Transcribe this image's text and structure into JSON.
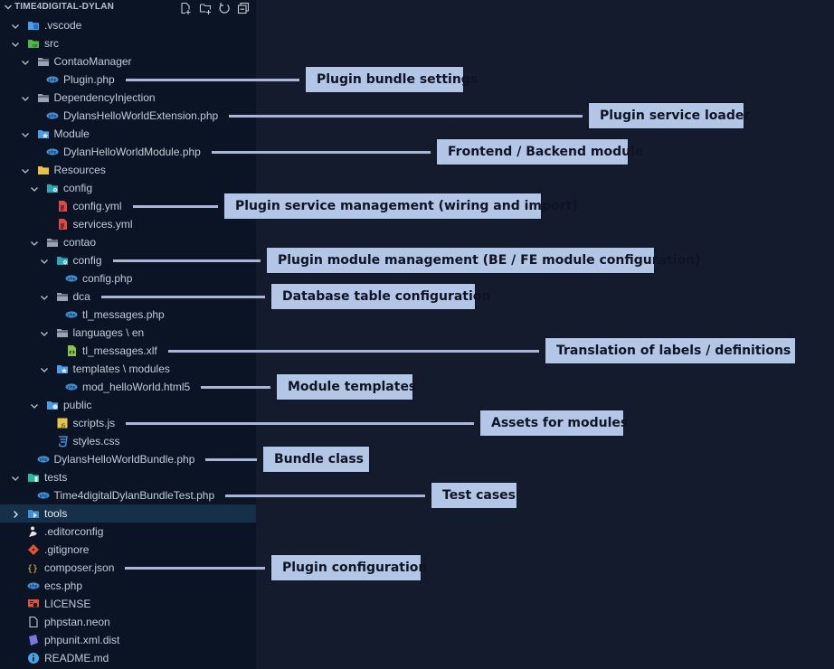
{
  "explorer": {
    "title": "TIME4DIGITAL-DYLAN",
    "toolbar": [
      {
        "name": "new-file",
        "tooltip_icon": "new-file-icon"
      },
      {
        "name": "new-folder",
        "tooltip_icon": "new-folder-icon"
      },
      {
        "name": "refresh",
        "tooltip_icon": "refresh-icon"
      },
      {
        "name": "collapse-all",
        "tooltip_icon": "collapse-all-icon"
      }
    ],
    "items": [
      {
        "label": ".vscode",
        "depth": 1,
        "type": "folder",
        "expanded": true,
        "icon": "vscode-folder-icon",
        "color": "#4a9ee8"
      },
      {
        "label": "src",
        "depth": 1,
        "type": "folder",
        "expanded": true,
        "icon": "src-folder-icon",
        "color": "#4db84a"
      },
      {
        "label": "ContaoManager",
        "depth": 2,
        "type": "folder",
        "expanded": true,
        "icon": "folder-icon",
        "color": "#9aa4b1"
      },
      {
        "label": "Plugin.php",
        "depth": 3,
        "type": "file",
        "icon": "php-icon",
        "color": "#3f8fd8"
      },
      {
        "label": "DependencyInjection",
        "depth": 2,
        "type": "folder",
        "expanded": true,
        "icon": "folder-icon",
        "color": "#9aa4b1"
      },
      {
        "label": "DylansHelloWorldExtension.php",
        "depth": 3,
        "type": "file",
        "icon": "php-icon",
        "color": "#3f8fd8"
      },
      {
        "label": "Module",
        "depth": 2,
        "type": "folder",
        "expanded": true,
        "icon": "module-folder-icon",
        "color": "#4a9ee8"
      },
      {
        "label": "DylanHelloWorldModule.php",
        "depth": 3,
        "type": "file",
        "icon": "php-icon",
        "color": "#3f8fd8"
      },
      {
        "label": "Resources",
        "depth": 2,
        "type": "folder",
        "expanded": true,
        "icon": "resources-folder-icon",
        "color": "#e8c04a"
      },
      {
        "label": "config",
        "depth": 3,
        "type": "folder",
        "expanded": true,
        "icon": "config-folder-icon",
        "color": "#2aa7b8"
      },
      {
        "label": "config.yml",
        "depth": 4,
        "type": "file",
        "icon": "yaml-icon",
        "color": "#e04848"
      },
      {
        "label": "services.yml",
        "depth": 4,
        "type": "file",
        "icon": "yaml-icon",
        "color": "#e04848"
      },
      {
        "label": "contao",
        "depth": 3,
        "type": "folder",
        "expanded": true,
        "icon": "folder-icon",
        "color": "#9aa4b1"
      },
      {
        "label": "config",
        "depth": 4,
        "type": "folder",
        "expanded": true,
        "icon": "config-folder-icon",
        "color": "#2aa7b8"
      },
      {
        "label": "config.php",
        "depth": 5,
        "type": "file",
        "icon": "php-icon",
        "color": "#3f8fd8"
      },
      {
        "label": "dca",
        "depth": 4,
        "type": "folder",
        "expanded": true,
        "icon": "folder-icon",
        "color": "#9aa4b1"
      },
      {
        "label": "tl_messages.php",
        "depth": 5,
        "type": "file",
        "icon": "php-icon",
        "color": "#3f8fd8"
      },
      {
        "label": "languages \\ en",
        "depth": 4,
        "type": "folder",
        "expanded": true,
        "icon": "folder-icon",
        "color": "#9aa4b1"
      },
      {
        "label": "tl_messages.xlf",
        "depth": 5,
        "type": "file",
        "icon": "xml-icon",
        "color": "#8bc34a"
      },
      {
        "label": "templates \\ modules",
        "depth": 4,
        "type": "folder",
        "expanded": true,
        "icon": "templates-folder-icon",
        "color": "#4a9ee8"
      },
      {
        "label": "mod_helloWorld.html5",
        "depth": 5,
        "type": "file",
        "icon": "php-icon",
        "color": "#3f8fd8"
      },
      {
        "label": "public",
        "depth": 3,
        "type": "folder",
        "expanded": true,
        "icon": "public-folder-icon",
        "color": "#4a9ee8"
      },
      {
        "label": "scripts.js",
        "depth": 4,
        "type": "file",
        "icon": "js-icon",
        "color": "#e8c44a"
      },
      {
        "label": "styles.css",
        "depth": 4,
        "type": "file",
        "icon": "css-icon",
        "color": "#3f8fd8"
      },
      {
        "label": "DylansHelloWorldBundle.php",
        "depth": 2,
        "type": "file",
        "icon": "php-icon",
        "color": "#3f8fd8"
      },
      {
        "label": "tests",
        "depth": 1,
        "type": "folder",
        "expanded": true,
        "icon": "tests-folder-icon",
        "color": "#2ab89a"
      },
      {
        "label": "Time4digitalDylanBundleTest.php",
        "depth": 2,
        "type": "file",
        "icon": "php-icon",
        "color": "#3f8fd8"
      },
      {
        "label": "tools",
        "depth": 1,
        "type": "folder",
        "expanded": false,
        "selected": true,
        "icon": "tools-folder-icon",
        "color": "#3f8fd8"
      },
      {
        "label": ".editorconfig",
        "depth": 1,
        "type": "file",
        "icon": "editorconfig-icon",
        "color": "#e6e6e6"
      },
      {
        "label": ".gitignore",
        "depth": 1,
        "type": "file",
        "icon": "git-icon",
        "color": "#e4552e"
      },
      {
        "label": "composer.json",
        "depth": 1,
        "type": "file",
        "icon": "json-icon",
        "color": "#e8c04a"
      },
      {
        "label": "ecs.php",
        "depth": 1,
        "type": "file",
        "icon": "php-icon",
        "color": "#3f8fd8"
      },
      {
        "label": "LICENSE",
        "depth": 1,
        "type": "file",
        "icon": "license-icon",
        "color": "#e4552e"
      },
      {
        "label": "phpstan.neon",
        "depth": 1,
        "type": "file",
        "icon": "file-icon",
        "color": "#c3cbd6"
      },
      {
        "label": "phpunit.xml.dist",
        "depth": 1,
        "type": "file",
        "icon": "phpunit-icon",
        "color": "#7a78e0"
      },
      {
        "label": "README.md",
        "depth": 1,
        "type": "file",
        "icon": "info-icon",
        "color": "#4aa3e8"
      }
    ]
  },
  "callouts": [
    {
      "item_index": 3,
      "text": "Plugin bundle settings"
    },
    {
      "item_index": 5,
      "text": "Plugin service loader"
    },
    {
      "item_index": 7,
      "text": "Frontend / Backend module"
    },
    {
      "item_index": 10,
      "text": "Plugin service management (wiring and import)"
    },
    {
      "item_index": 13,
      "text": "Plugin module management (BE / FE module configuration)"
    },
    {
      "item_index": 15,
      "text": "Database table configuration"
    },
    {
      "item_index": 18,
      "text": "Translation of labels / definitions"
    },
    {
      "item_index": 20,
      "text": "Module templates"
    },
    {
      "item_index": 22,
      "text": "Assets for modules"
    },
    {
      "item_index": 24,
      "text": "Bundle class"
    },
    {
      "item_index": 26,
      "text": "Test cases"
    },
    {
      "item_index": 30,
      "text": "Plugin configuration"
    }
  ],
  "colors": {
    "sidebar_bg": "#0b1424",
    "main_bg": "#131b2c",
    "selected_row": "#16304a",
    "callout_bg": "#b4c6e6",
    "connector": "#a9b6d6"
  }
}
